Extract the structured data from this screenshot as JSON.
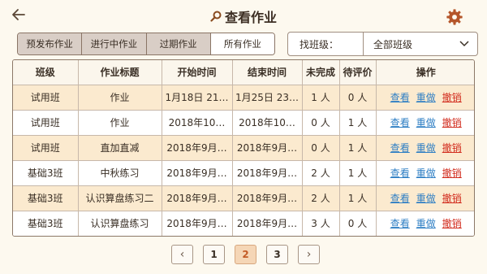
{
  "header": {
    "title": "查看作业",
    "back_icon": "arrow-left-icon",
    "search_icon": "search-icon",
    "settings_icon": "gear-icon"
  },
  "tabs": [
    {
      "label": "预发布作业",
      "active": false
    },
    {
      "label": "进行中作业",
      "active": false
    },
    {
      "label": "过期作业",
      "active": false
    },
    {
      "label": "所有作业",
      "active": true
    }
  ],
  "filter": {
    "label": "找班级：",
    "selected": "全部班级"
  },
  "table": {
    "columns": [
      "班级",
      "作业标题",
      "开始时间",
      "结束时间",
      "未完成",
      "待评价",
      "操作"
    ],
    "rows": [
      {
        "class": "试用班",
        "title": "作业",
        "start": "1月18日 21…",
        "end": "1月25日 23…",
        "incomplete": "1 人",
        "pending": "0 人"
      },
      {
        "class": "试用班",
        "title": "作业",
        "start": "2018年10…",
        "end": "2018年10…",
        "incomplete": "0 人",
        "pending": "1 人"
      },
      {
        "class": "试用班",
        "title": "直加直减",
        "start": "2018年9月…",
        "end": "2018年9月…",
        "incomplete": "0 人",
        "pending": "1 人"
      },
      {
        "class": "基础3班",
        "title": "中秋练习",
        "start": "2018年9月…",
        "end": "2018年9月…",
        "incomplete": "2 人",
        "pending": "1 人"
      },
      {
        "class": "基础3班",
        "title": "认识算盘练习二",
        "start": "2018年9月…",
        "end": "2018年9月…",
        "incomplete": "2 人",
        "pending": "1 人"
      },
      {
        "class": "基础3班",
        "title": "认识算盘练习",
        "start": "2018年9月…",
        "end": "2018年9月…",
        "incomplete": "3 人",
        "pending": "0 人"
      }
    ],
    "actions": {
      "view": "查看",
      "redo": "重做",
      "revoke": "撤销"
    }
  },
  "pagination": {
    "prev": "‹",
    "next": "›",
    "pages": [
      "1",
      "2",
      "3"
    ],
    "current": "2"
  },
  "colors": {
    "background": "#fdf9ef",
    "row_highlight": "#fbeacf",
    "link_blue": "#2f7fc4",
    "link_red": "#d22d1f",
    "active_page": "#c35a24"
  }
}
